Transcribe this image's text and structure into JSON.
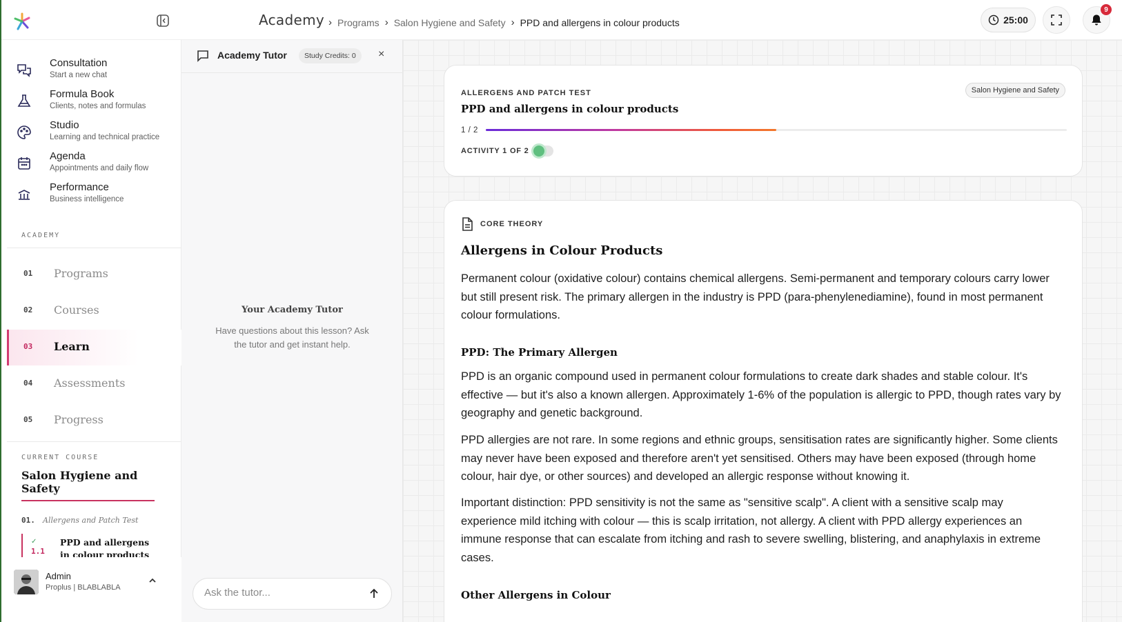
{
  "app": {
    "breadcrumb_root": "Academy",
    "breadcrumb": [
      "Programs",
      "Salon Hygiene and Safety"
    ],
    "breadcrumb_current": "PPD and allergens in colour products",
    "timer": "25:00",
    "notifications_count": "9"
  },
  "sidebar": {
    "nav": [
      {
        "title": "Consultation",
        "subtitle": "Start a new chat",
        "icon": "chat-bubbles-icon"
      },
      {
        "title": "Formula Book",
        "subtitle": "Clients, notes and formulas",
        "icon": "flask-icon"
      },
      {
        "title": "Studio",
        "subtitle": "Learning and technical practice",
        "icon": "palette-icon"
      },
      {
        "title": "Agenda",
        "subtitle": "Appointments and daily flow",
        "icon": "calendar-icon"
      },
      {
        "title": "Performance",
        "subtitle": "Business intelligence",
        "icon": "bank-chart-icon"
      }
    ],
    "academy_label": "ACADEMY",
    "steps": [
      {
        "num": "01",
        "label": "Programs"
      },
      {
        "num": "02",
        "label": "Courses"
      },
      {
        "num": "03",
        "label": "Learn"
      },
      {
        "num": "04",
        "label": "Assessments"
      },
      {
        "num": "05",
        "label": "Progress"
      }
    ],
    "active_step": "Learn",
    "current_course_label": "CURRENT COURSE",
    "current_course": "Salon Hygiene and Safety",
    "module_num": "01.",
    "module_name": "Allergens and Patch Test",
    "lesson_check": "✓",
    "lesson_num": "1.1",
    "lesson_name": "PPD and allergens in colour products",
    "user": {
      "name": "Admin",
      "org": "Proplus | BLABLABLA"
    }
  },
  "tutor": {
    "title": "Academy Tutor",
    "credits": "Study Credits: 0",
    "close": "×",
    "empty_title": "Your Academy Tutor",
    "empty_text": "Have questions about this lesson? Ask the tutor and get instant help.",
    "input_placeholder": "Ask the tutor..."
  },
  "progress": {
    "kicker": "ALLERGENS AND PATCH TEST",
    "title": "PPD and allergens in colour products",
    "course_pill": "Salon Hygiene and Safety",
    "count": "1 / 2",
    "fraction": 0.5,
    "activity": "ACTIVITY 1 OF 2"
  },
  "theory": {
    "kicker": "CORE THEORY",
    "heading": "Allergens in Colour Products",
    "intro": "Permanent colour (oxidative colour) contains chemical allergens. Semi-permanent and temporary colours carry lower but still present risk. The primary allergen in the industry is PPD (para-phenylenediamine), found in most permanent colour formulations.",
    "ppd_heading": "PPD: The Primary Allergen",
    "ppd_p1": "PPD is an organic compound used in permanent colour formulations to create dark shades and stable colour. It's effective — but it's also a known allergen. Approximately 1-6% of the population is allergic to PPD, though rates vary by geography and genetic background.",
    "ppd_p2": "PPD allergies are not rare. In some regions and ethnic groups, sensitisation rates are significantly higher. Some clients may never have been exposed and therefore aren't yet sensitised. Others may have been exposed (through home colour, hair dye, or other sources) and developed an allergic response without knowing it.",
    "ppd_p3": "Important distinction: PPD sensitivity is not the same as \"sensitive scalp\". A client with a sensitive scalp may experience mild itching with colour — this is scalp irritation, not allergy. A client with PPD allergy experiences an immune response that can escalate from itching and rash to severe swelling, blistering, and anaphylaxis in extreme cases.",
    "other_heading": "Other Allergens in Colour"
  },
  "colors": {
    "accent": "#c8325f",
    "progress_start": "#6a2bd9",
    "progress_end": "#f3782c",
    "activity_done": "#5fbf7f"
  }
}
